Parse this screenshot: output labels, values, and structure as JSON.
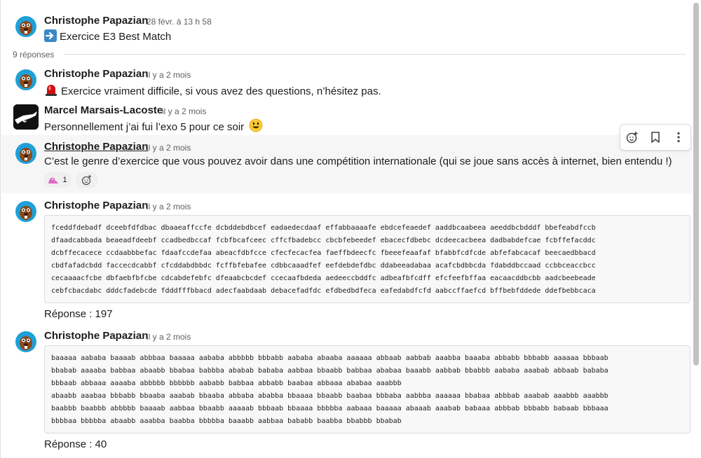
{
  "thread": {
    "parent": {
      "author": "Christophe Papazian",
      "timestamp": "28 févr. à 13 h 58",
      "text": "Exercice E3 Best Match",
      "emoji_icon": "arrow-right-icon"
    },
    "replies_label": "9 réponses",
    "messages": [
      {
        "author": "Christophe Papazian",
        "timestamp": "il y a 2 mois",
        "text": "Exercice vraiment difficile, si vous avez des questions, n’hésitez pas.",
        "emoji_icon": "rotating-light-icon"
      },
      {
        "author": "Marcel Marsais-Lacoste",
        "timestamp": "il y a 2 mois",
        "text": "Personnellement j’ai fui l’exo 5 pour ce soir",
        "emoji_icon": "smiley-icon"
      },
      {
        "author": "Christophe Papazian",
        "timestamp": "il y a 2 mois",
        "text": "C’est le genre d’exercice que vous pouvez avoir dans une compétition internationale (qui se joue sans accès à internet, bien entendu !)",
        "reaction_count": "1",
        "reaction_icon": "pink-blob-icon"
      },
      {
        "author": "Christophe Papazian",
        "timestamp": "il y a 2 mois",
        "code": "fceddfdebadf dceebfdfdbac dbaaeaffccfe dcbddebdbcef eadaedecdaaf effabbaaaafe ebdcefeaedef aaddbcaabeea aeeddbcbdddf bbefeabdfccb\ndfaadcabbada beaeadfdeebf ccadbedbccaf fcbfbcafceec cffcfbadebcc cbcbfebeedef ebacecfdbebc dcdeecacbeea dadbabdefcae fcbffefacddc\ndcbffecacece ccdaabbbefac fdaafccdefaa abeacfdbfcce cfecfecacfea faeffbdeecfc fbeeefeaafaf bfabbfcdfcde abfefabcacaf beecaedbbacd\ncbdfafadcbdd faccecdcabbf cfcddabdbbdc fcffbfebafee cdbbcaaadfef eefdebdefdbc ddabeeadabaa acafcbdbbcda fdabddbccaad ccbbceaccbcc\ncecaaaacfcbe dbfaebfbfcbe cdcabdefebfc dfeaabcbcdef ccecaafbdeda aedeeccbddfc adbeafbfcdff efcfeefbffaa eacaacddbcbb aadcbeebeade\ncebfcbacdabc dddcfadebcde fdddfffbbacd adecfaabdaab debacefadfdc efdbedbdfeca eafedabdfcfd aabccffaefcd bffbebfddede ddefbebbcaca",
        "answer": "Réponse : 197"
      },
      {
        "author": "Christophe Papazian",
        "timestamp": "il y a 2 mois",
        "code": "baaaaa aababa baaaab abbbaa baaaaa aababa abbbbb bbbabb aababa abaaba aaaaaa abbaab aabbab aaabba baaaba abbabb bbbabb aaaaaa bbbaab\nbbabab aaaaba babbaa abaabb bbabaa babbba ababab bababa aabbaa bbaabb babbaa ababaa baaabb aabbab bbabbb aababa aaabab abbaab bababa\nbbbaab abbaaa aaaaba abbbbb bbbbbb aababb babbaa abbabb baabaa abbaaa ababaa aaabbb\nabaabb aaabaa bbbabb bbaaba aaabab bbaaba abbaba ababba bbaaaa bbaabb baabaa bbbaba aabbba aaaaaa bbabaa abbbab aaabab aaabbb aaabbb\nbaabbb baabbb abbbbb baaaab aabbaa bbaabb aaaaab bbbaab bbaaaa bbbbba aabaaa baaaaa abaaab aaabab babaaa abbbab bbbabb babaab bbbaaa\nbbbbaa bbbbba abaabb aaabba baabba bbbbba baaabb aabbaa bababb baabba bbabbb bbabab",
        "answer": "Réponse : 40"
      }
    ]
  },
  "toolbar": {
    "add_reaction_icon": "add-reaction-icon",
    "bookmark_icon": "bookmark-icon",
    "more_icon": "more-vertical-icon"
  },
  "colors": {
    "avatar_bg": "#1fa0d8",
    "beaver": "#8a4a1c",
    "highlight_bg": "#f6f6f6",
    "code_bg": "#f8f8f8"
  }
}
